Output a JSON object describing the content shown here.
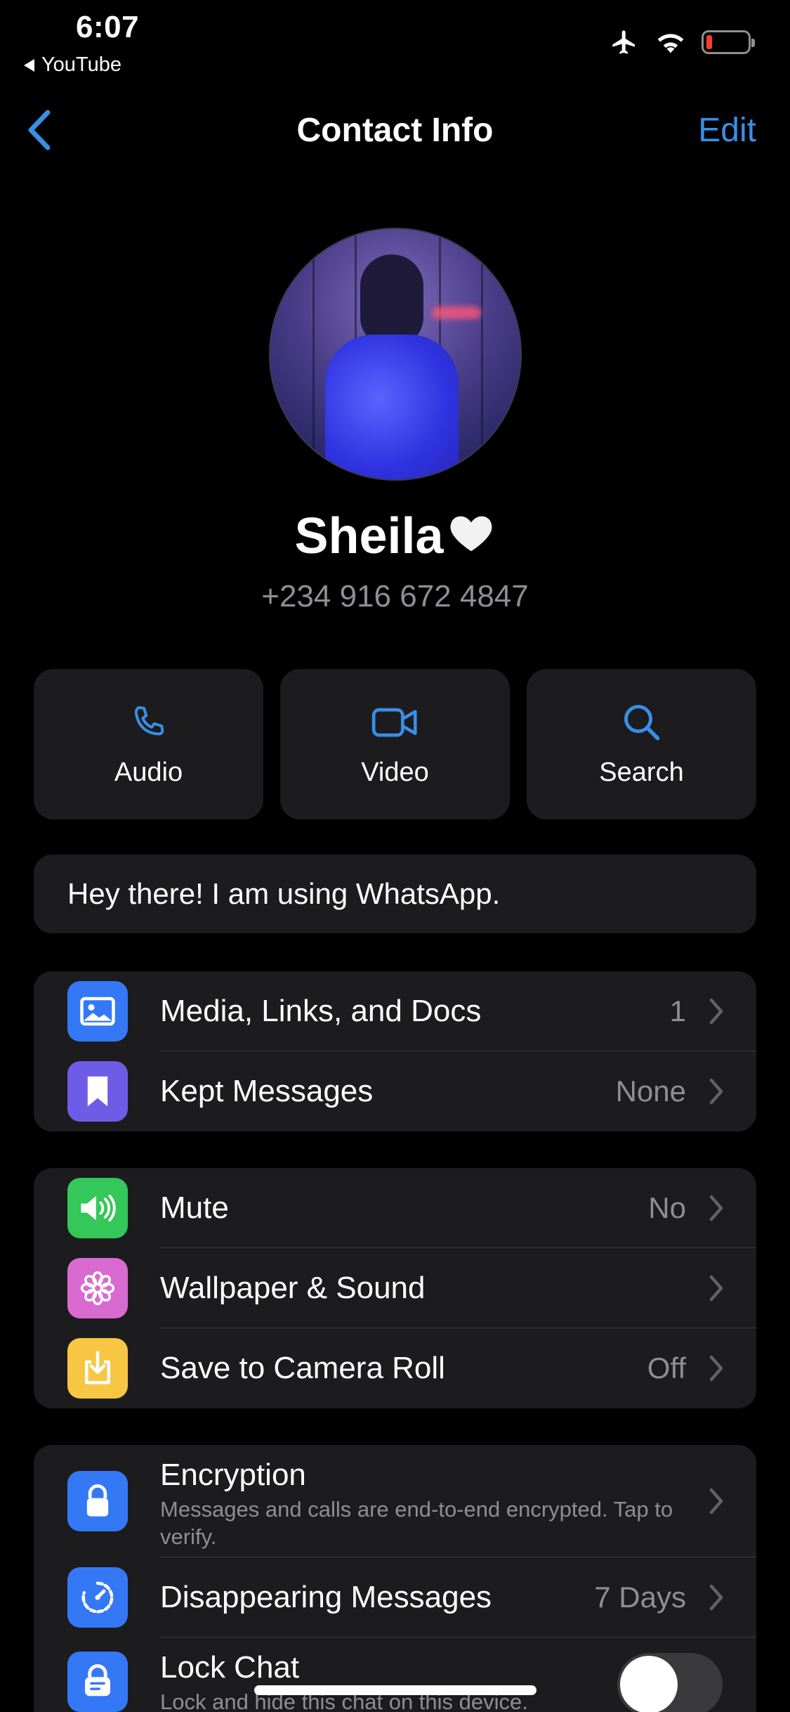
{
  "status_bar": {
    "time": "6:07",
    "back_app": "YouTube"
  },
  "nav": {
    "title": "Contact Info",
    "edit_label": "Edit"
  },
  "profile": {
    "name": "Sheila",
    "phone": "+234 916 672 4847"
  },
  "actions": [
    {
      "label": "Audio",
      "icon": "phone-icon"
    },
    {
      "label": "Video",
      "icon": "video-camera-icon"
    },
    {
      "label": "Search",
      "icon": "search-icon"
    }
  ],
  "about": {
    "text": "Hey there! I am using WhatsApp."
  },
  "group1": [
    {
      "label": "Media, Links, and Docs",
      "value": "1",
      "icon": "photo-icon",
      "color": "#3478f6"
    },
    {
      "label": "Kept Messages",
      "value": "None",
      "icon": "bookmark-icon",
      "color": "#6e5ce6"
    }
  ],
  "group2": [
    {
      "label": "Mute",
      "value": "No",
      "icon": "speaker-icon",
      "color": "#34c759"
    },
    {
      "label": "Wallpaper & Sound",
      "value": "",
      "icon": "flower-icon",
      "color": "#d96ad0"
    },
    {
      "label": "Save to Camera Roll",
      "value": "Off",
      "icon": "download-icon",
      "color": "#f7c744"
    }
  ],
  "group3": [
    {
      "label": "Encryption",
      "sub": "Messages and calls are end-to-end encrypted. Tap to verify.",
      "icon": "lock-icon",
      "color": "#3478f6"
    },
    {
      "label": "Disappearing Messages",
      "value": "7 Days",
      "icon": "timer-icon",
      "color": "#3478f6"
    },
    {
      "label": "Lock Chat",
      "sub": "Lock and hide this chat on this device.",
      "icon": "lock-chat-icon",
      "color": "#3478f6"
    }
  ]
}
